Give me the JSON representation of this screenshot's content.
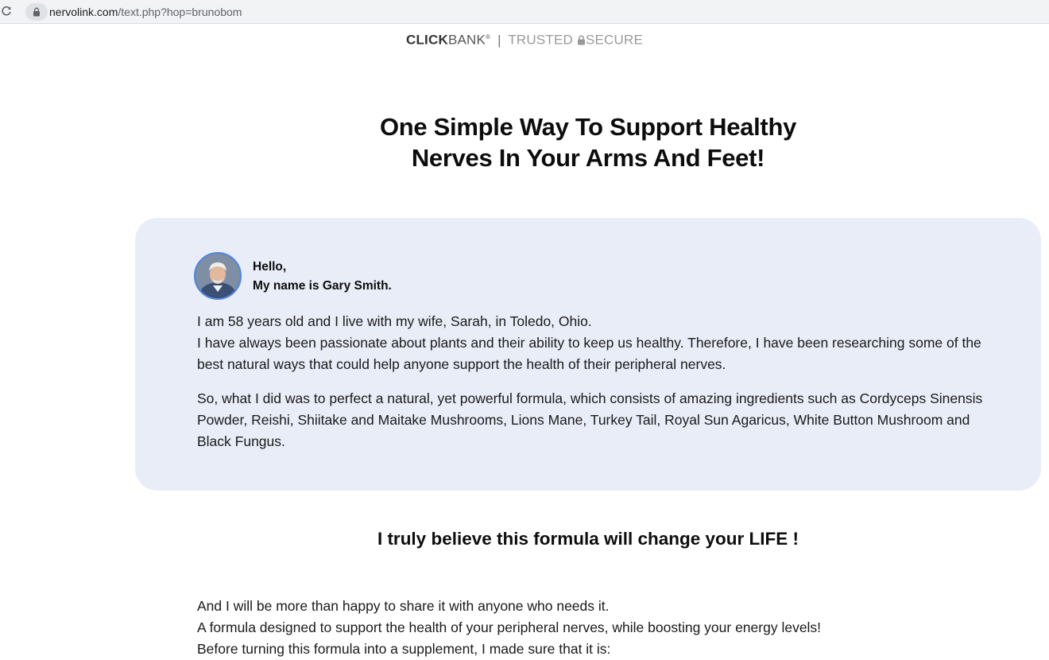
{
  "browser": {
    "url_domain": "nervolink.com",
    "url_path": "/text.php?hop=brunobom",
    "reload_icon": "reload-icon",
    "lock_icon": "lock-icon"
  },
  "trust_bar": {
    "brand_bold": "CLICK",
    "brand_light": "BANK",
    "registered": "®",
    "separator": "|",
    "trusted": "TRUSTED",
    "secure": "SECURE",
    "padlock_icon": "padlock-icon"
  },
  "headline": {
    "line1": "One Simple Way To Support Healthy",
    "line2": "Nerves In Your Arms And Feet!"
  },
  "intro": {
    "avatar_icon": "avatar-photo",
    "greeting_line1": "Hello,",
    "greeting_line2": "My name is Gary Smith.",
    "paragraph1_line1": "I am 58 years old and I live with my wife, Sarah, in Toledo, Ohio.",
    "paragraph1_line2": "I have always been passionate about plants and their ability to keep us healthy. Therefore, I have been researching some of the best natural ways that could help anyone support the health of their peripheral nerves.",
    "paragraph2": "So, what I did was to perfect a natural, yet powerful formula, which consists of amazing ingredients such as Cordyceps Sinensis Powder, Reishi, Shiitake and Maitake Mushrooms, Lions Mane, Turkey Tail, Royal Sun Agaricus, White Button Mushroom and Black Fungus."
  },
  "subheadline": "I truly believe this formula will change your LIFE !",
  "body": {
    "line1": "And I will be more than happy to share it with anyone who needs it.",
    "line2": "A formula designed to support the health of your peripheral nerves, while boosting your energy levels!",
    "line3": "Before turning this formula into a supplement, I made sure that it is:"
  },
  "colors": {
    "card_background": "#e9edf8",
    "avatar_ring": "#4f86e6",
    "headline": "#0d0d0d"
  }
}
